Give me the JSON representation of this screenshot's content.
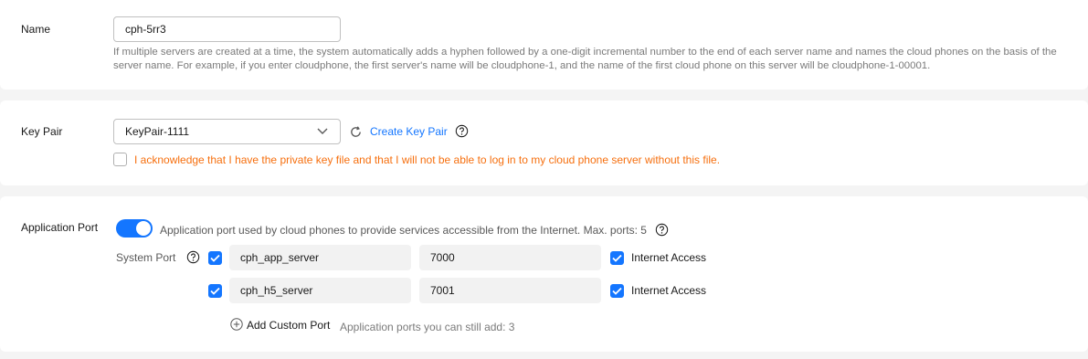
{
  "name_section": {
    "label": "Name",
    "value": "cph-5rr3",
    "hint": "If multiple servers are created at a time, the system automatically adds a hyphen followed by a one-digit incremental number to the end of each server name and names the cloud phones on the basis of the server name. For example, if you enter cloudphone, the first server's name will be cloudphone-1, and the name of the first cloud phone on this server will be cloudphone-1-00001."
  },
  "key_pair_section": {
    "label": "Key Pair",
    "selected": "KeyPair-1111",
    "create_link": "Create Key Pair",
    "acknowledge_text": "I acknowledge that I have the private key file and that I will not be able to log in to my cloud phone server without this file.",
    "acknowledge_checked": false
  },
  "app_port_section": {
    "label": "Application Port",
    "toggle_on": true,
    "toggle_text": "Application port used by cloud phones to provide services accessible from the Internet. Max. ports: 5",
    "system_port_label": "System Port",
    "ports": [
      {
        "checked": true,
        "name": "cph_app_server",
        "port": "7000",
        "internet_access_checked": true,
        "internet_access_label": "Internet Access"
      },
      {
        "checked": true,
        "name": "cph_h5_server",
        "port": "7001",
        "internet_access_checked": true,
        "internet_access_label": "Internet Access"
      }
    ],
    "add_custom_port": "Add Custom Port",
    "remaining_text": "Application ports you can still add: 3"
  },
  "colors": {
    "accent": "#1476ff",
    "warning": "#f66f0e"
  }
}
